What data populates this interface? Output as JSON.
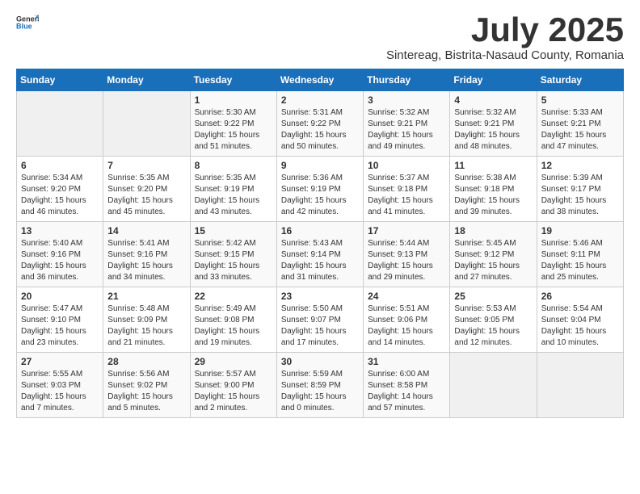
{
  "logo": {
    "line1": "General",
    "line2": "Blue"
  },
  "title": "July 2025",
  "location": "Sintereag, Bistrita-Nasaud County, Romania",
  "weekdays": [
    "Sunday",
    "Monday",
    "Tuesday",
    "Wednesday",
    "Thursday",
    "Friday",
    "Saturday"
  ],
  "weeks": [
    [
      {
        "day": "",
        "info": ""
      },
      {
        "day": "",
        "info": ""
      },
      {
        "day": "1",
        "info": "Sunrise: 5:30 AM\nSunset: 9:22 PM\nDaylight: 15 hours\nand 51 minutes."
      },
      {
        "day": "2",
        "info": "Sunrise: 5:31 AM\nSunset: 9:22 PM\nDaylight: 15 hours\nand 50 minutes."
      },
      {
        "day": "3",
        "info": "Sunrise: 5:32 AM\nSunset: 9:21 PM\nDaylight: 15 hours\nand 49 minutes."
      },
      {
        "day": "4",
        "info": "Sunrise: 5:32 AM\nSunset: 9:21 PM\nDaylight: 15 hours\nand 48 minutes."
      },
      {
        "day": "5",
        "info": "Sunrise: 5:33 AM\nSunset: 9:21 PM\nDaylight: 15 hours\nand 47 minutes."
      }
    ],
    [
      {
        "day": "6",
        "info": "Sunrise: 5:34 AM\nSunset: 9:20 PM\nDaylight: 15 hours\nand 46 minutes."
      },
      {
        "day": "7",
        "info": "Sunrise: 5:35 AM\nSunset: 9:20 PM\nDaylight: 15 hours\nand 45 minutes."
      },
      {
        "day": "8",
        "info": "Sunrise: 5:35 AM\nSunset: 9:19 PM\nDaylight: 15 hours\nand 43 minutes."
      },
      {
        "day": "9",
        "info": "Sunrise: 5:36 AM\nSunset: 9:19 PM\nDaylight: 15 hours\nand 42 minutes."
      },
      {
        "day": "10",
        "info": "Sunrise: 5:37 AM\nSunset: 9:18 PM\nDaylight: 15 hours\nand 41 minutes."
      },
      {
        "day": "11",
        "info": "Sunrise: 5:38 AM\nSunset: 9:18 PM\nDaylight: 15 hours\nand 39 minutes."
      },
      {
        "day": "12",
        "info": "Sunrise: 5:39 AM\nSunset: 9:17 PM\nDaylight: 15 hours\nand 38 minutes."
      }
    ],
    [
      {
        "day": "13",
        "info": "Sunrise: 5:40 AM\nSunset: 9:16 PM\nDaylight: 15 hours\nand 36 minutes."
      },
      {
        "day": "14",
        "info": "Sunrise: 5:41 AM\nSunset: 9:16 PM\nDaylight: 15 hours\nand 34 minutes."
      },
      {
        "day": "15",
        "info": "Sunrise: 5:42 AM\nSunset: 9:15 PM\nDaylight: 15 hours\nand 33 minutes."
      },
      {
        "day": "16",
        "info": "Sunrise: 5:43 AM\nSunset: 9:14 PM\nDaylight: 15 hours\nand 31 minutes."
      },
      {
        "day": "17",
        "info": "Sunrise: 5:44 AM\nSunset: 9:13 PM\nDaylight: 15 hours\nand 29 minutes."
      },
      {
        "day": "18",
        "info": "Sunrise: 5:45 AM\nSunset: 9:12 PM\nDaylight: 15 hours\nand 27 minutes."
      },
      {
        "day": "19",
        "info": "Sunrise: 5:46 AM\nSunset: 9:11 PM\nDaylight: 15 hours\nand 25 minutes."
      }
    ],
    [
      {
        "day": "20",
        "info": "Sunrise: 5:47 AM\nSunset: 9:10 PM\nDaylight: 15 hours\nand 23 minutes."
      },
      {
        "day": "21",
        "info": "Sunrise: 5:48 AM\nSunset: 9:09 PM\nDaylight: 15 hours\nand 21 minutes."
      },
      {
        "day": "22",
        "info": "Sunrise: 5:49 AM\nSunset: 9:08 PM\nDaylight: 15 hours\nand 19 minutes."
      },
      {
        "day": "23",
        "info": "Sunrise: 5:50 AM\nSunset: 9:07 PM\nDaylight: 15 hours\nand 17 minutes."
      },
      {
        "day": "24",
        "info": "Sunrise: 5:51 AM\nSunset: 9:06 PM\nDaylight: 15 hours\nand 14 minutes."
      },
      {
        "day": "25",
        "info": "Sunrise: 5:53 AM\nSunset: 9:05 PM\nDaylight: 15 hours\nand 12 minutes."
      },
      {
        "day": "26",
        "info": "Sunrise: 5:54 AM\nSunset: 9:04 PM\nDaylight: 15 hours\nand 10 minutes."
      }
    ],
    [
      {
        "day": "27",
        "info": "Sunrise: 5:55 AM\nSunset: 9:03 PM\nDaylight: 15 hours\nand 7 minutes."
      },
      {
        "day": "28",
        "info": "Sunrise: 5:56 AM\nSunset: 9:02 PM\nDaylight: 15 hours\nand 5 minutes."
      },
      {
        "day": "29",
        "info": "Sunrise: 5:57 AM\nSunset: 9:00 PM\nDaylight: 15 hours\nand 2 minutes."
      },
      {
        "day": "30",
        "info": "Sunrise: 5:59 AM\nSunset: 8:59 PM\nDaylight: 15 hours\nand 0 minutes."
      },
      {
        "day": "31",
        "info": "Sunrise: 6:00 AM\nSunset: 8:58 PM\nDaylight: 14 hours\nand 57 minutes."
      },
      {
        "day": "",
        "info": ""
      },
      {
        "day": "",
        "info": ""
      }
    ]
  ]
}
